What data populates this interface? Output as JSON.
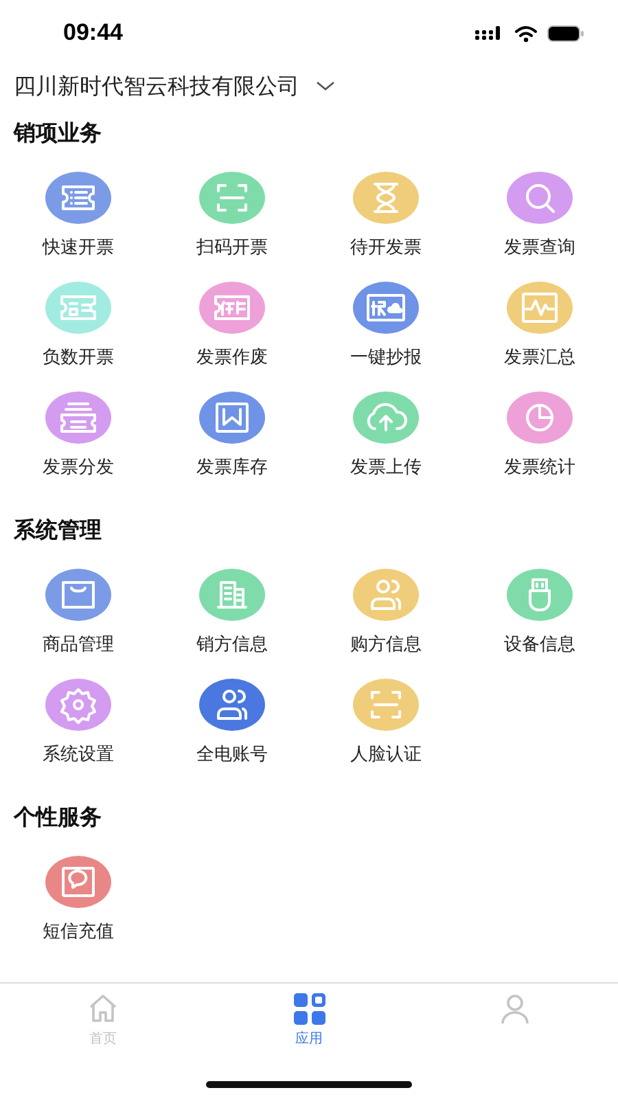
{
  "status_bar": {
    "time": "09:44"
  },
  "company": {
    "name": "四川新时代智云科技有限公司"
  },
  "sections": [
    {
      "title": "销项业务",
      "items": [
        {
          "label": "快速开票",
          "color": "#7b9be6"
        },
        {
          "label": "扫码开票",
          "color": "#7fdcaa"
        },
        {
          "label": "待开发票",
          "color": "#f0cd7a"
        },
        {
          "label": "发票查询",
          "color": "#d39cf0"
        },
        {
          "label": "负数开票",
          "color": "#a2ebe1"
        },
        {
          "label": "发票作废",
          "color": "#eea0d8"
        },
        {
          "label": "一键抄报",
          "color": "#6f93e6"
        },
        {
          "label": "发票汇总",
          "color": "#f0cd7a"
        },
        {
          "label": "发票分发",
          "color": "#d39cf0"
        },
        {
          "label": "发票库存",
          "color": "#6f93e6"
        },
        {
          "label": "发票上传",
          "color": "#7fdcaa"
        },
        {
          "label": "发票统计",
          "color": "#eea0d8"
        }
      ]
    },
    {
      "title": "系统管理",
      "items": [
        {
          "label": "商品管理",
          "color": "#7b9be6"
        },
        {
          "label": "销方信息",
          "color": "#7fdcaa"
        },
        {
          "label": "购方信息",
          "color": "#f0cd7a"
        },
        {
          "label": "设备信息",
          "color": "#7fdcaa"
        },
        {
          "label": "系统设置",
          "color": "#d39cf0"
        },
        {
          "label": "全电账号",
          "color": "#4a78e0"
        },
        {
          "label": "人脸认证",
          "color": "#f0cd7a"
        }
      ]
    },
    {
      "title": "个性服务",
      "items": [
        {
          "label": "短信充值",
          "color": "#e98787"
        }
      ]
    }
  ],
  "tabs": [
    {
      "kind": "home",
      "label": "首页",
      "selected": false
    },
    {
      "kind": "apps",
      "label": "应用",
      "selected": true
    },
    {
      "kind": "user",
      "selected": false
    }
  ]
}
